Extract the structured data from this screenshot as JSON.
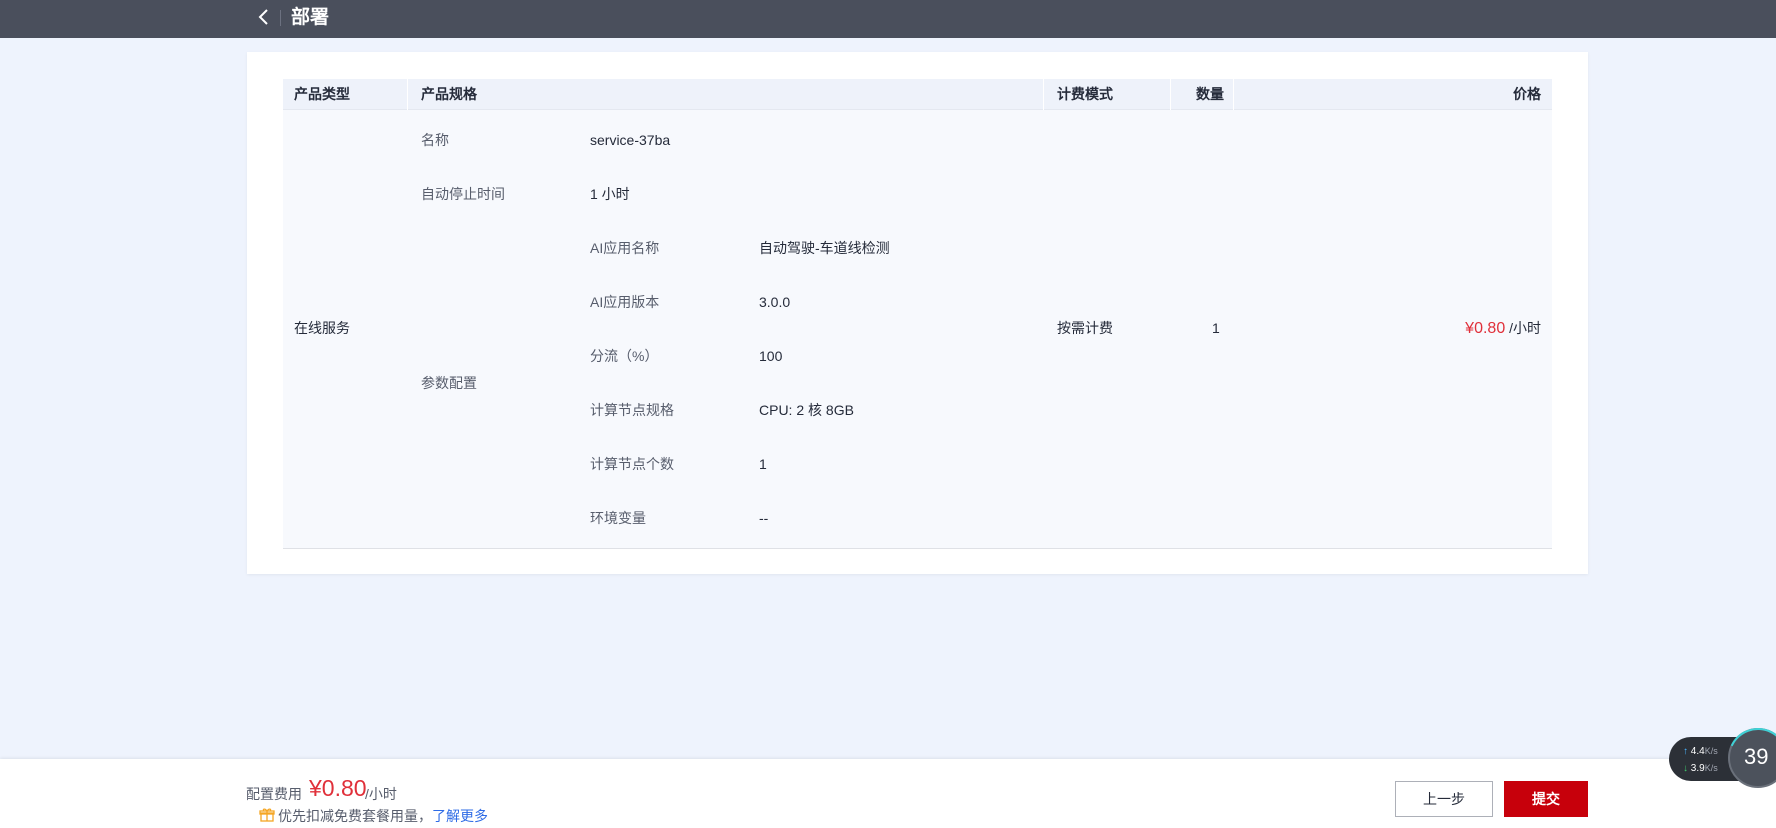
{
  "header": {
    "title": "部署",
    "back_icon": "chevron-left-icon"
  },
  "table": {
    "columns": [
      "产品类型",
      "产品规格",
      "计费模式",
      "数量",
      "价格"
    ],
    "row": {
      "product_type": "在线服务",
      "specs": [
        {
          "key": "名称",
          "value": "service-37ba"
        },
        {
          "key": "自动停止时间",
          "value": "1 小时"
        }
      ],
      "param_config_label": "参数配置",
      "params": [
        {
          "key": "AI应用名称",
          "value": "自动驾驶-车道线检测"
        },
        {
          "key": "AI应用版本",
          "value": "3.0.0"
        },
        {
          "key": "分流（%）",
          "value": "100"
        },
        {
          "key": "计算节点规格",
          "value": "CPU: 2 核 8GB"
        },
        {
          "key": "计算节点个数",
          "value": "1"
        },
        {
          "key": "环境变量",
          "value": "--"
        }
      ],
      "billing_mode": "按需计费",
      "quantity": "1",
      "price": "¥0.80",
      "price_unit": "/小时"
    }
  },
  "footer": {
    "fee_label": "配置费用",
    "fee_amount": "¥0.80",
    "fee_unit": "/小时",
    "notice": "优先扣减免费套餐用量，",
    "learn_more": "了解更多",
    "prev_button": "上一步",
    "submit_button": "提交"
  },
  "network_widget": {
    "upload": "4.4",
    "download": "3.9",
    "unit": "K/s",
    "percent": "39"
  },
  "colors": {
    "accent_red": "#c7000b",
    "price_red": "#e0303a",
    "link_blue": "#2e6be6",
    "topbar": "#4a4f5c"
  }
}
